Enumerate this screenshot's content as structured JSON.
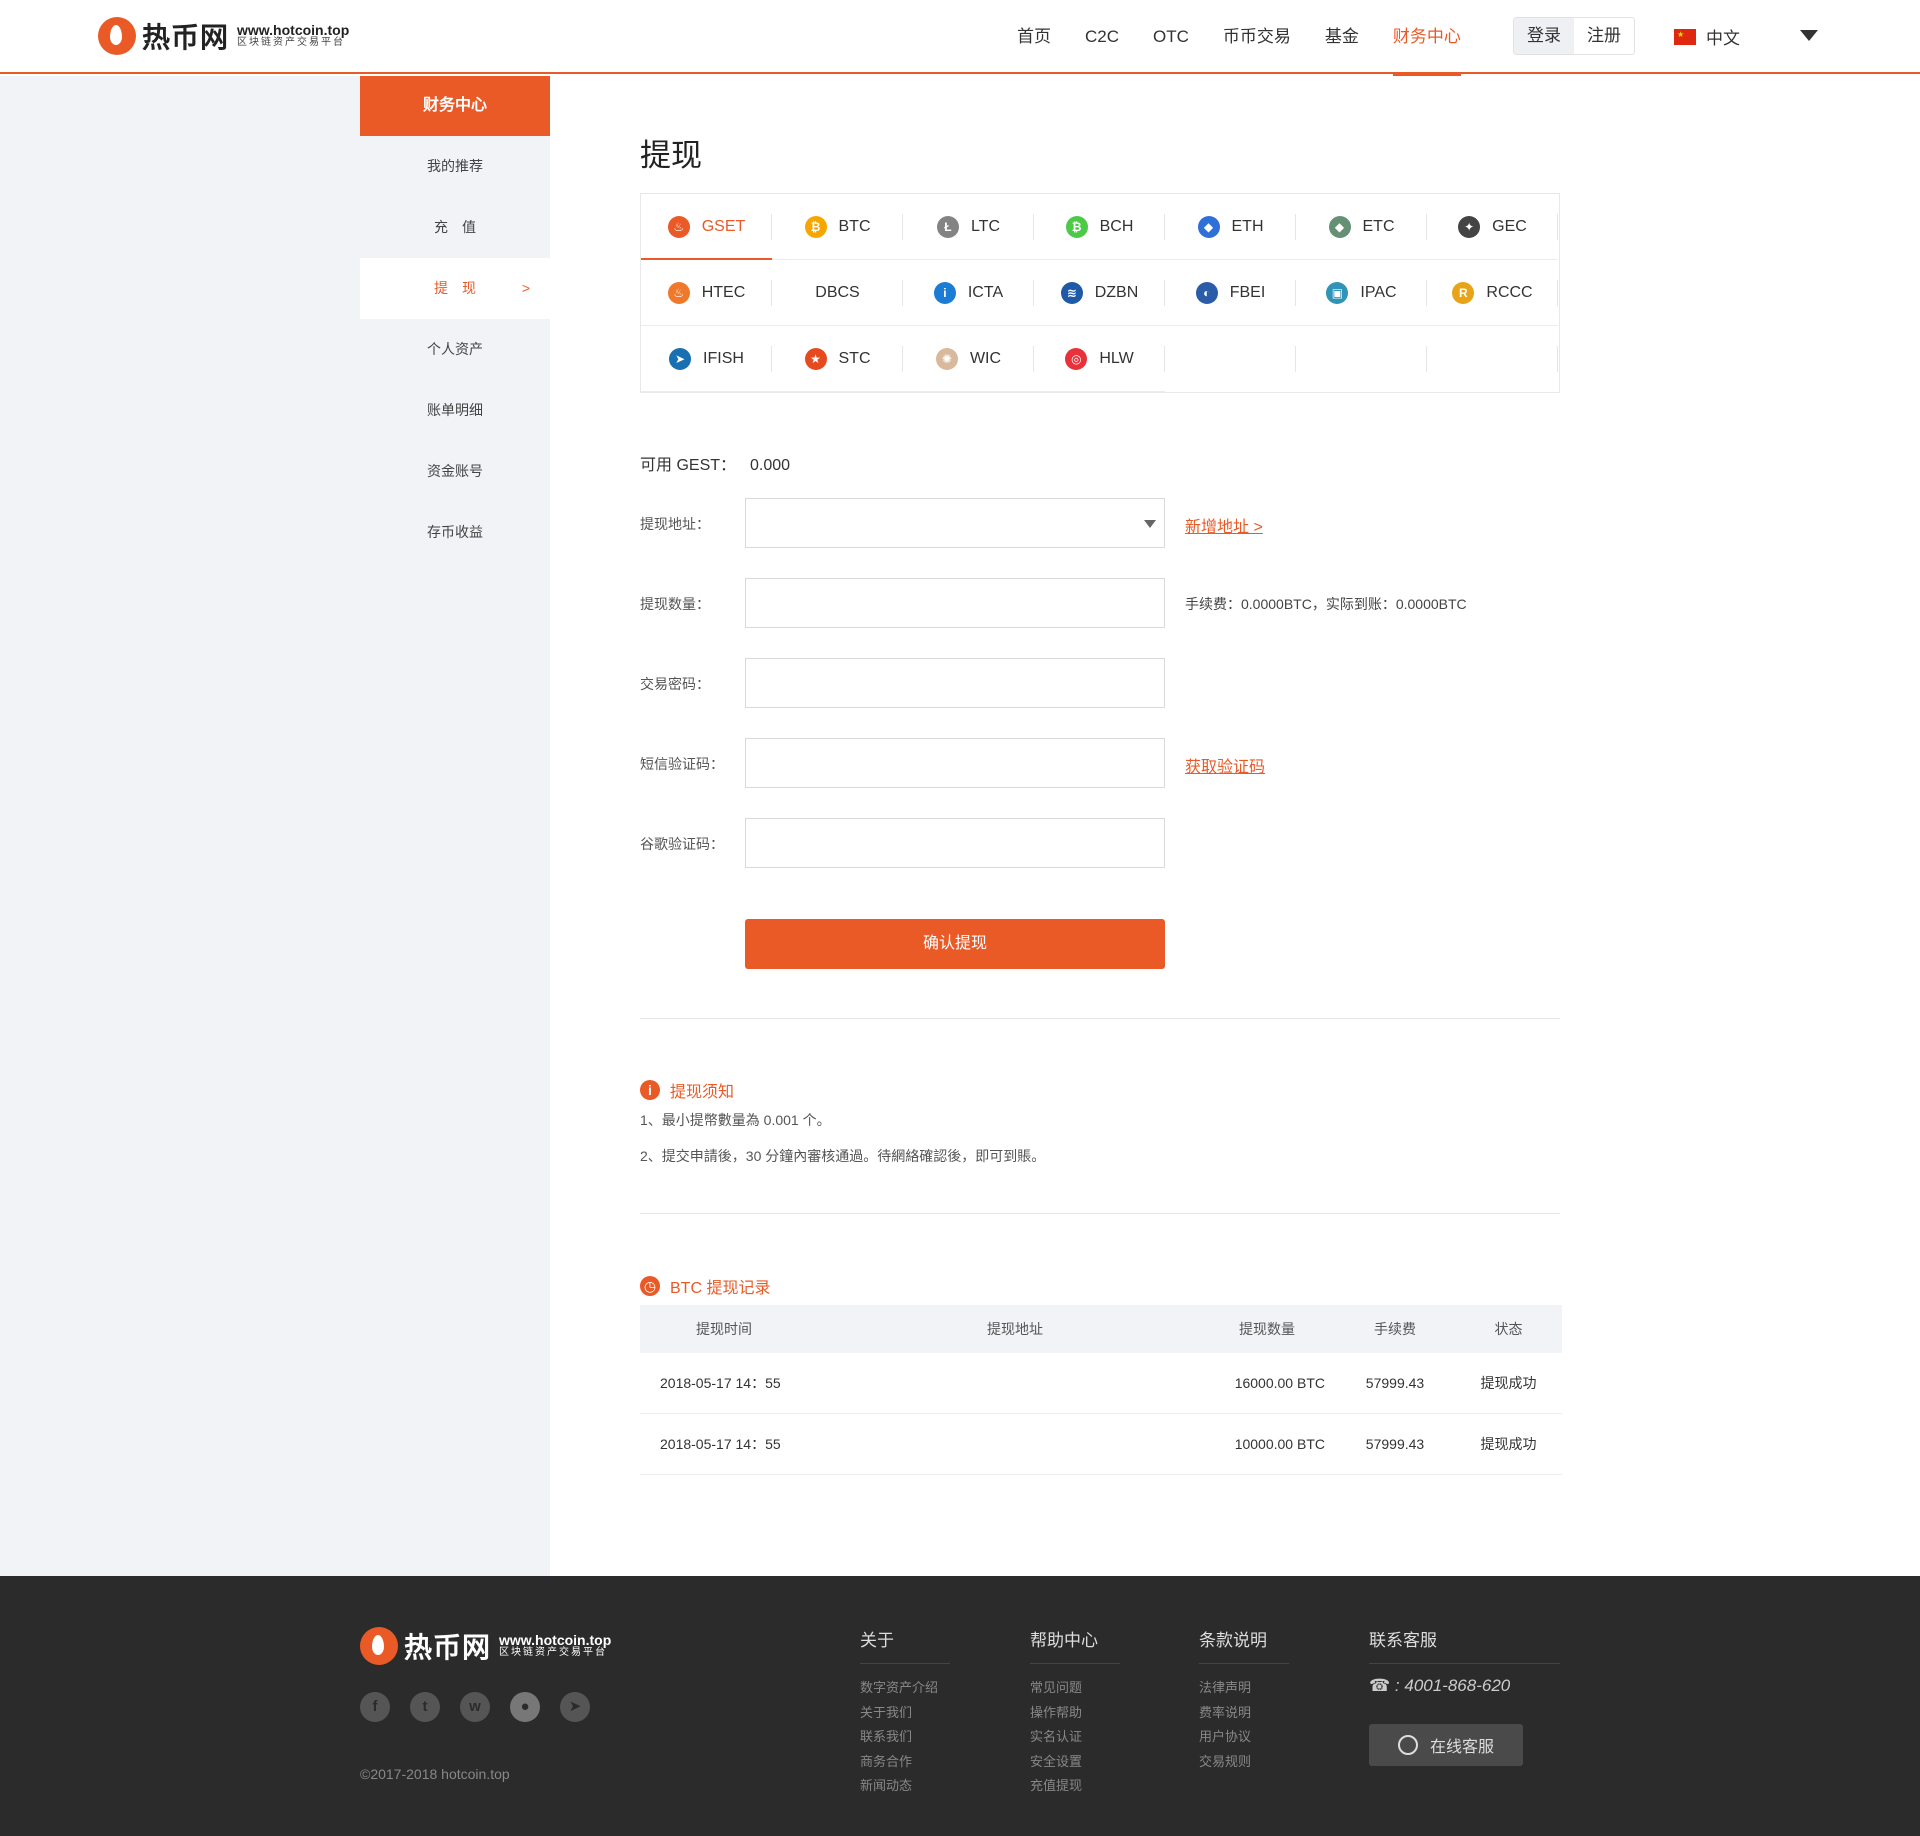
{
  "header": {
    "logo_cn": "热币网",
    "logo_url": "www.hotcoin.top",
    "logo_sub": "区块链资产交易平台",
    "nav": [
      "首页",
      "C2C",
      "OTC",
      "币币交易",
      "基金",
      "财务中心"
    ],
    "login": "登录",
    "register": "注册",
    "lang": "中文"
  },
  "sidebar": {
    "title": "财务中心",
    "items": [
      "我的推荐",
      "充　值",
      "提　现",
      "个人资产",
      "账单明细",
      "资金账号",
      "存币收益"
    ],
    "active_arrow": ">"
  },
  "main": {
    "title": "提现",
    "coins": [
      {
        "name": "GSET",
        "icon": "flame-icon",
        "color": "#ea5a27"
      },
      {
        "name": "BTC",
        "icon": "bitcoin-icon",
        "color": "#f7a600"
      },
      {
        "name": "LTC",
        "icon": "litecoin-icon",
        "color": "#838383"
      },
      {
        "name": "BCH",
        "icon": "bitcoin-cash-icon",
        "color": "#4cc947"
      },
      {
        "name": "ETH",
        "icon": "ethereum-icon",
        "color": "#2e6fd8"
      },
      {
        "name": "ETC",
        "icon": "ethereum-classic-icon",
        "color": "#669073"
      },
      {
        "name": "GEC",
        "icon": "gec-icon",
        "color": "#444444"
      },
      {
        "name": "HTEC",
        "icon": "htec-flame-icon",
        "color": "#f0782a"
      },
      {
        "name": "DBCS",
        "icon": "",
        "color": ""
      },
      {
        "name": "ICTA",
        "icon": "icta-icon",
        "color": "#1b7cd6"
      },
      {
        "name": "DZBN",
        "icon": "dzbn-icon",
        "color": "#1f5aa6"
      },
      {
        "name": "FBEI",
        "icon": "fbei-icon",
        "color": "#2a5caa"
      },
      {
        "name": "IPAC",
        "icon": "ipac-cube-icon",
        "color": "#2f94b8"
      },
      {
        "name": "RCCC",
        "icon": "rccc-icon",
        "color": "#e8a317"
      },
      {
        "name": "IFISH",
        "icon": "ifish-icon",
        "color": "#1a6fb0"
      },
      {
        "name": "STC",
        "icon": "starchain-icon",
        "color": "#e54b1e"
      },
      {
        "name": "WIC",
        "icon": "wic-icon",
        "color": "#d9b99b"
      },
      {
        "name": "HLW",
        "icon": "hlw-icon",
        "color": "#e8313a"
      }
    ],
    "available_label": "可用 GEST：",
    "available_value": "0.000",
    "form": {
      "address_label": "提现地址：",
      "add_address": "新增地址 >",
      "amount_label": "提现数量：",
      "fee_note": "手续费：0.0000BTC，实际到账：0.0000BTC",
      "password_label": "交易密码：",
      "sms_label": "短信验证码：",
      "get_code": "获取验证码",
      "google_label": "谷歌验证码：",
      "submit": "确认提现"
    },
    "notice": {
      "title": "提现须知",
      "lines": [
        "1、最小提幣數量為 0.001 个。",
        "2、提交申請後，30 分鐘內審核通過。待網絡確認後，即可到賬。"
      ]
    },
    "records": {
      "title": "BTC 提现记录",
      "headers": [
        "提现时间",
        "提现地址",
        "提现数量",
        "手续费",
        "状态"
      ],
      "rows": [
        [
          "2018-05-17  14：55",
          "",
          "16000.00 BTC",
          "57999.43",
          "提现成功"
        ],
        [
          "2018-05-17  14：55",
          "",
          "10000.00 BTC",
          "57999.43",
          "提现成功"
        ]
      ]
    }
  },
  "footer": {
    "logo_cn": "热币网",
    "logo_url": "www.hotcoin.top",
    "logo_sub": "区块链资产交易平台",
    "copyright": "©2017-2018 hotcoin.top",
    "cols": [
      {
        "title": "关于",
        "items": [
          "数字资产介绍",
          "关于我们",
          "联系我们",
          "商务合作",
          "新闻动态"
        ]
      },
      {
        "title": "帮助中心",
        "items": [
          "常见问题",
          "操作帮助",
          "实名认证",
          "安全设置",
          "充值提现"
        ]
      },
      {
        "title": "条款说明",
        "items": [
          "法律声明",
          "费率说明",
          "用户协议",
          "交易规则"
        ]
      }
    ],
    "contact_title": "联系客服",
    "phone": "4001-868-620",
    "service": "在线客服"
  },
  "colors": {
    "accent": "#ea5a27",
    "sidebar_bg": "#f2f3f7",
    "footer_bg": "#2b2b2b"
  }
}
